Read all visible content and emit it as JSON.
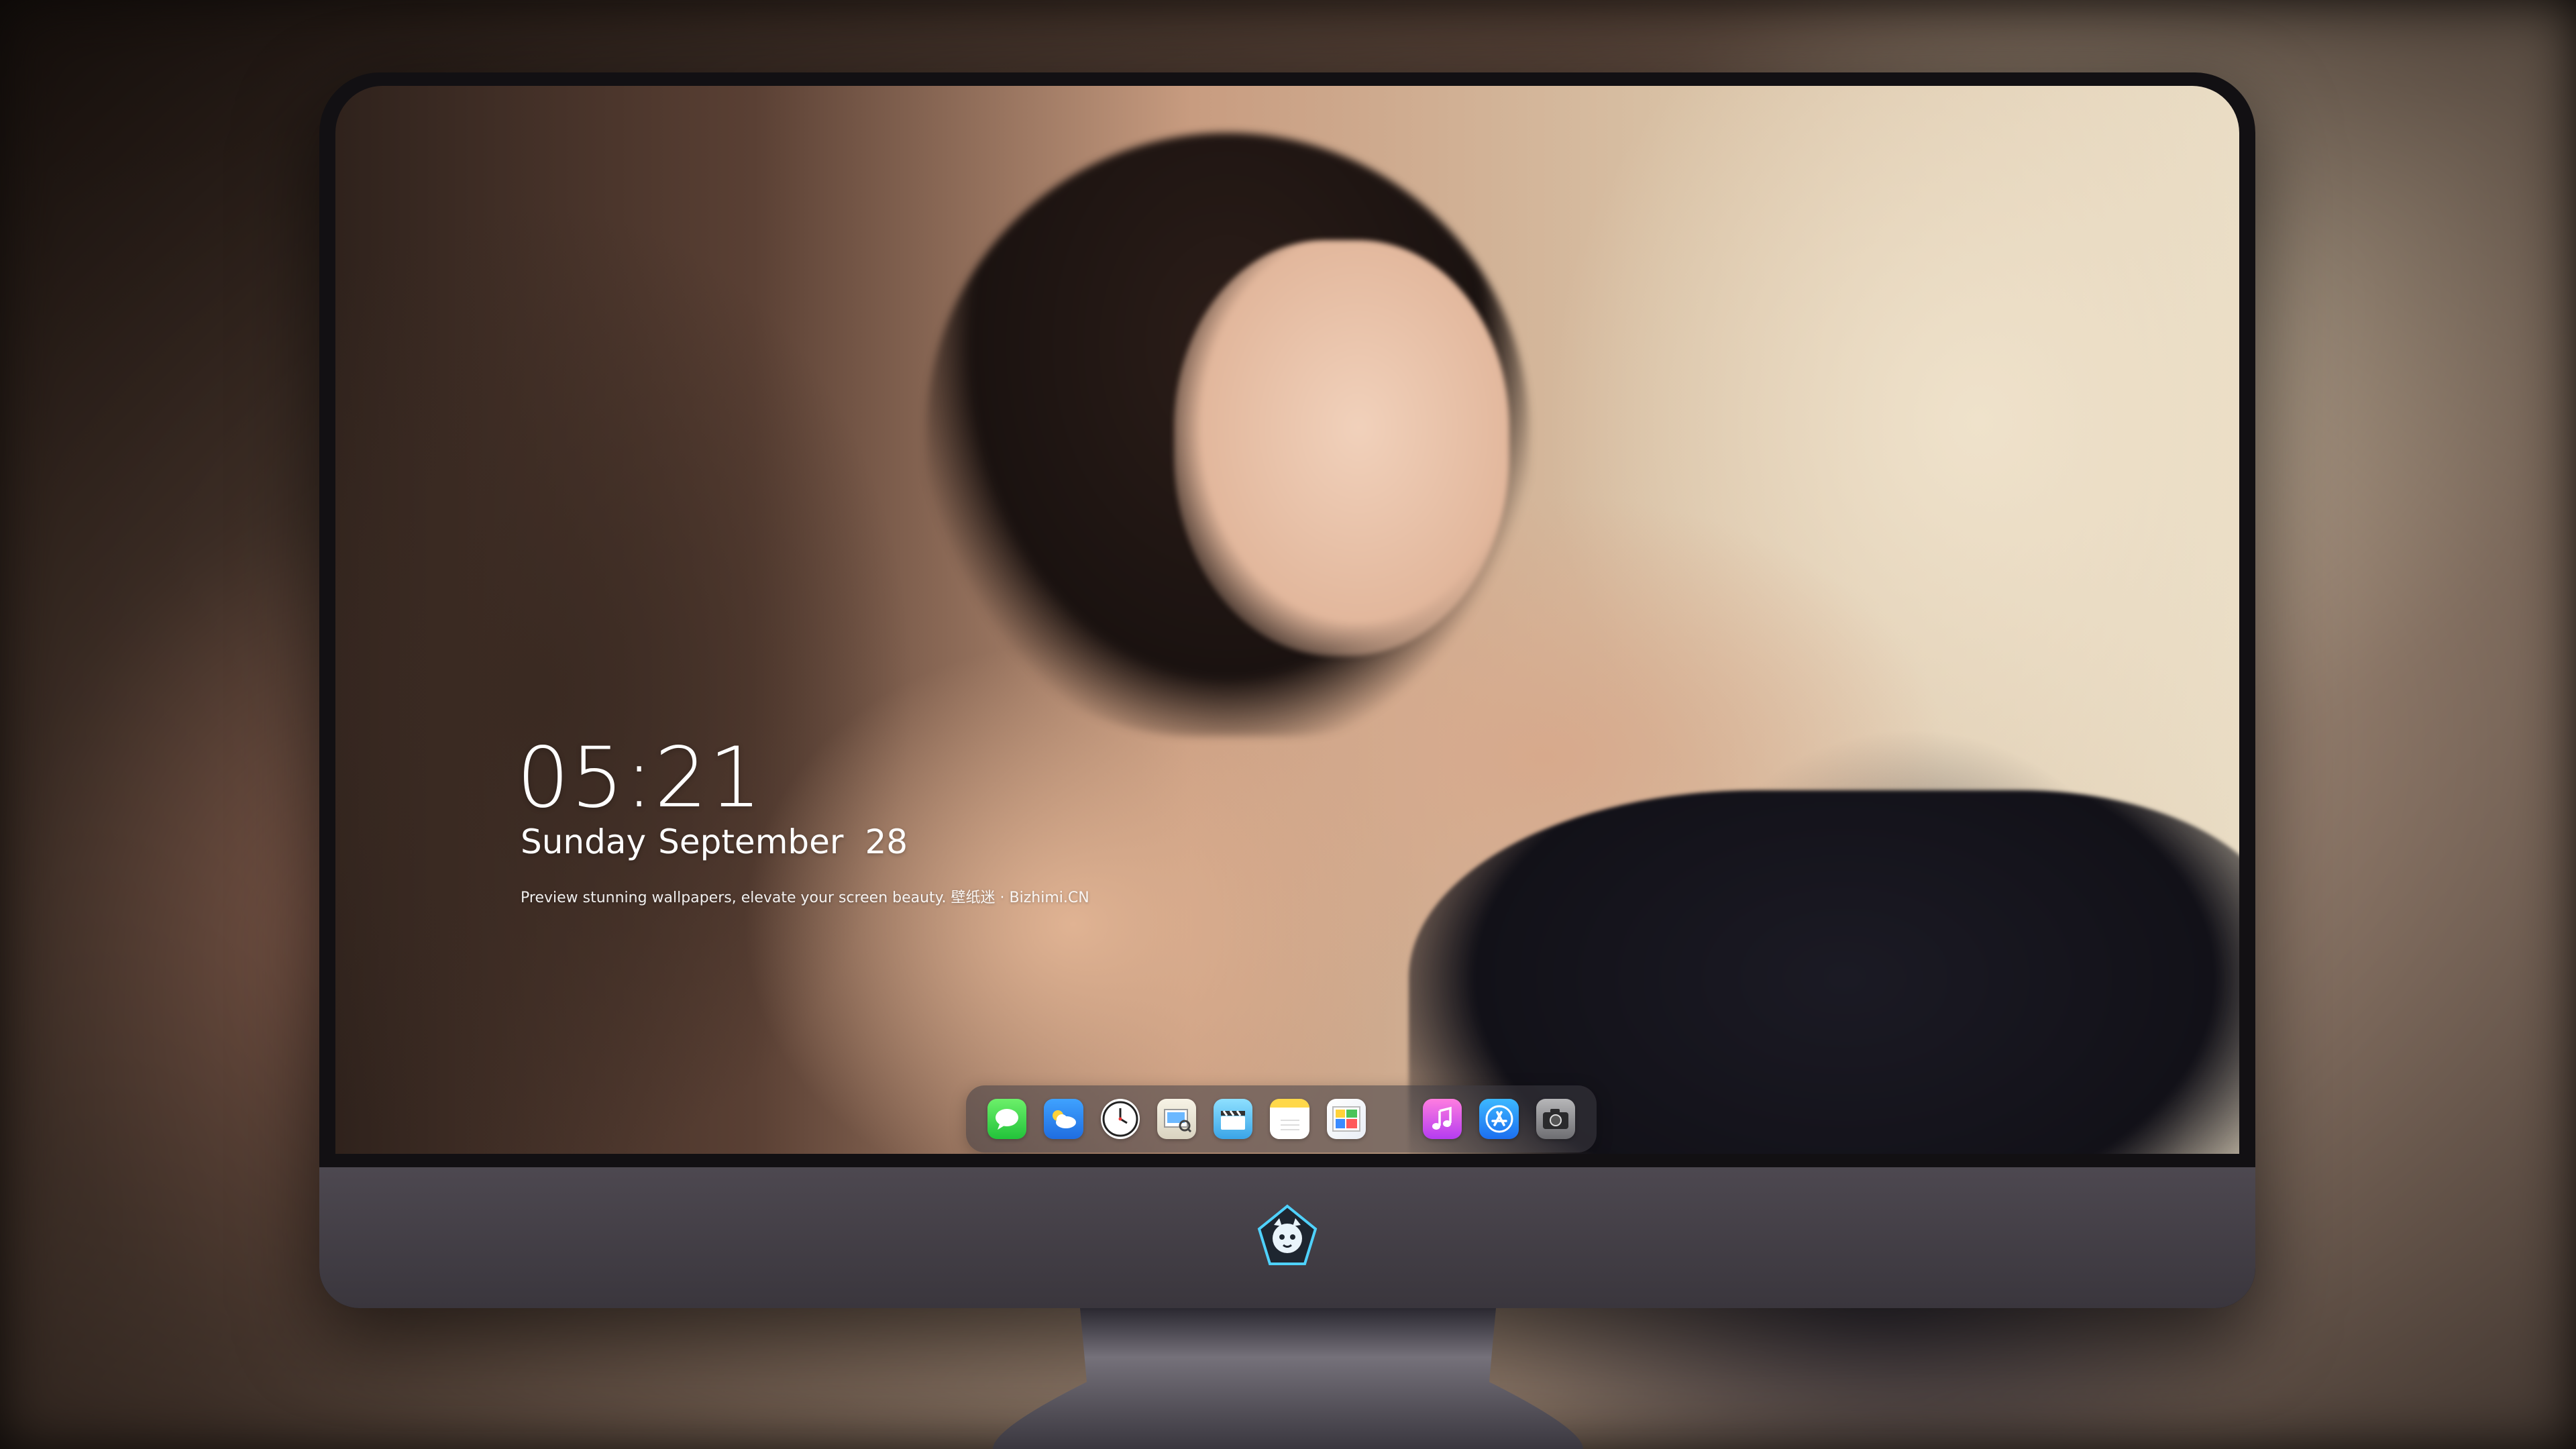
{
  "lockscreen": {
    "time": "05:21",
    "weekday": "Sunday",
    "month": "September",
    "day": "28",
    "tagline": "Preview stunning wallpapers, elevate your screen beauty. 壁纸迷 · Bizhimi.CN"
  },
  "dock": {
    "apps": [
      {
        "name": "Messages",
        "icon": "messages-icon"
      },
      {
        "name": "Weather",
        "icon": "weather-icon"
      },
      {
        "name": "Clock",
        "icon": "clock-icon"
      },
      {
        "name": "Preview",
        "icon": "preview-icon"
      },
      {
        "name": "Video",
        "icon": "clapperboard-icon"
      },
      {
        "name": "Notes",
        "icon": "notes-icon"
      },
      {
        "name": "Photos",
        "icon": "photos-icon"
      },
      {
        "name": "Music",
        "icon": "music-icon"
      },
      {
        "name": "App Store",
        "icon": "app-store-icon"
      },
      {
        "name": "Camera",
        "icon": "camera-icon"
      }
    ]
  },
  "colors": {
    "monitor_bezel": "#121013",
    "monitor_chin": "#4d4850",
    "text": "#ffffff"
  }
}
